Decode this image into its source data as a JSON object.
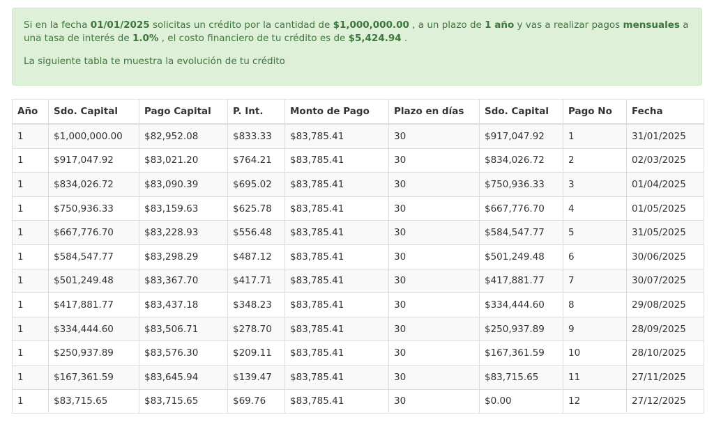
{
  "summary": {
    "p1_t1": "Si en la fecha ",
    "date": "01/01/2025",
    "p1_t2": " solicitas un crédito por la cantidad de ",
    "amount": "$1,000,000.00",
    "p1_t3": " , a un plazo de ",
    "term": "1 año",
    "p1_t4": " y vas a realizar pagos ",
    "frequency": "mensuales",
    "p1_t5": " a una tasa de interés de ",
    "rate": "1.0%",
    "p1_t6": " , el costo financiero de tu crédito es de ",
    "cost": "$5,424.94",
    "p1_t7": " .",
    "p2": "La siguiente tabla te muestra la evolución de tu crédito"
  },
  "table": {
    "headers": [
      "Año",
      "Sdo. Capital",
      "Pago Capital",
      "P. Int.",
      "Monto de Pago",
      "Plazo en días",
      "Sdo. Capital",
      "Pago No",
      "Fecha"
    ],
    "rows": [
      [
        "1",
        "$1,000,000.00",
        "$82,952.08",
        "$833.33",
        "$83,785.41",
        "30",
        "$917,047.92",
        "1",
        "31/01/2025"
      ],
      [
        "1",
        "$917,047.92",
        "$83,021.20",
        "$764.21",
        "$83,785.41",
        "30",
        "$834,026.72",
        "2",
        "02/03/2025"
      ],
      [
        "1",
        "$834,026.72",
        "$83,090.39",
        "$695.02",
        "$83,785.41",
        "30",
        "$750,936.33",
        "3",
        "01/04/2025"
      ],
      [
        "1",
        "$750,936.33",
        "$83,159.63",
        "$625.78",
        "$83,785.41",
        "30",
        "$667,776.70",
        "4",
        "01/05/2025"
      ],
      [
        "1",
        "$667,776.70",
        "$83,228.93",
        "$556.48",
        "$83,785.41",
        "30",
        "$584,547.77",
        "5",
        "31/05/2025"
      ],
      [
        "1",
        "$584,547.77",
        "$83,298.29",
        "$487.12",
        "$83,785.41",
        "30",
        "$501,249.48",
        "6",
        "30/06/2025"
      ],
      [
        "1",
        "$501,249.48",
        "$83,367.70",
        "$417.71",
        "$83,785.41",
        "30",
        "$417,881.77",
        "7",
        "30/07/2025"
      ],
      [
        "1",
        "$417,881.77",
        "$83,437.18",
        "$348.23",
        "$83,785.41",
        "30",
        "$334,444.60",
        "8",
        "29/08/2025"
      ],
      [
        "1",
        "$334,444.60",
        "$83,506.71",
        "$278.70",
        "$83,785.41",
        "30",
        "$250,937.89",
        "9",
        "28/09/2025"
      ],
      [
        "1",
        "$250,937.89",
        "$83,576.30",
        "$209.11",
        "$83,785.41",
        "30",
        "$167,361.59",
        "10",
        "28/10/2025"
      ],
      [
        "1",
        "$167,361.59",
        "$83,645.94",
        "$139.47",
        "$83,785.41",
        "30",
        "$83,715.65",
        "11",
        "27/11/2025"
      ],
      [
        "1",
        "$83,715.65",
        "$83,715.65",
        "$69.76",
        "$83,785.41",
        "30",
        "$0.00",
        "12",
        "27/12/2025"
      ]
    ]
  },
  "colors": {
    "alert_bg": "#dff0d8",
    "alert_text": "#3c763d",
    "table_border": "#dddddd",
    "row_stripe": "#f9f9f9"
  }
}
